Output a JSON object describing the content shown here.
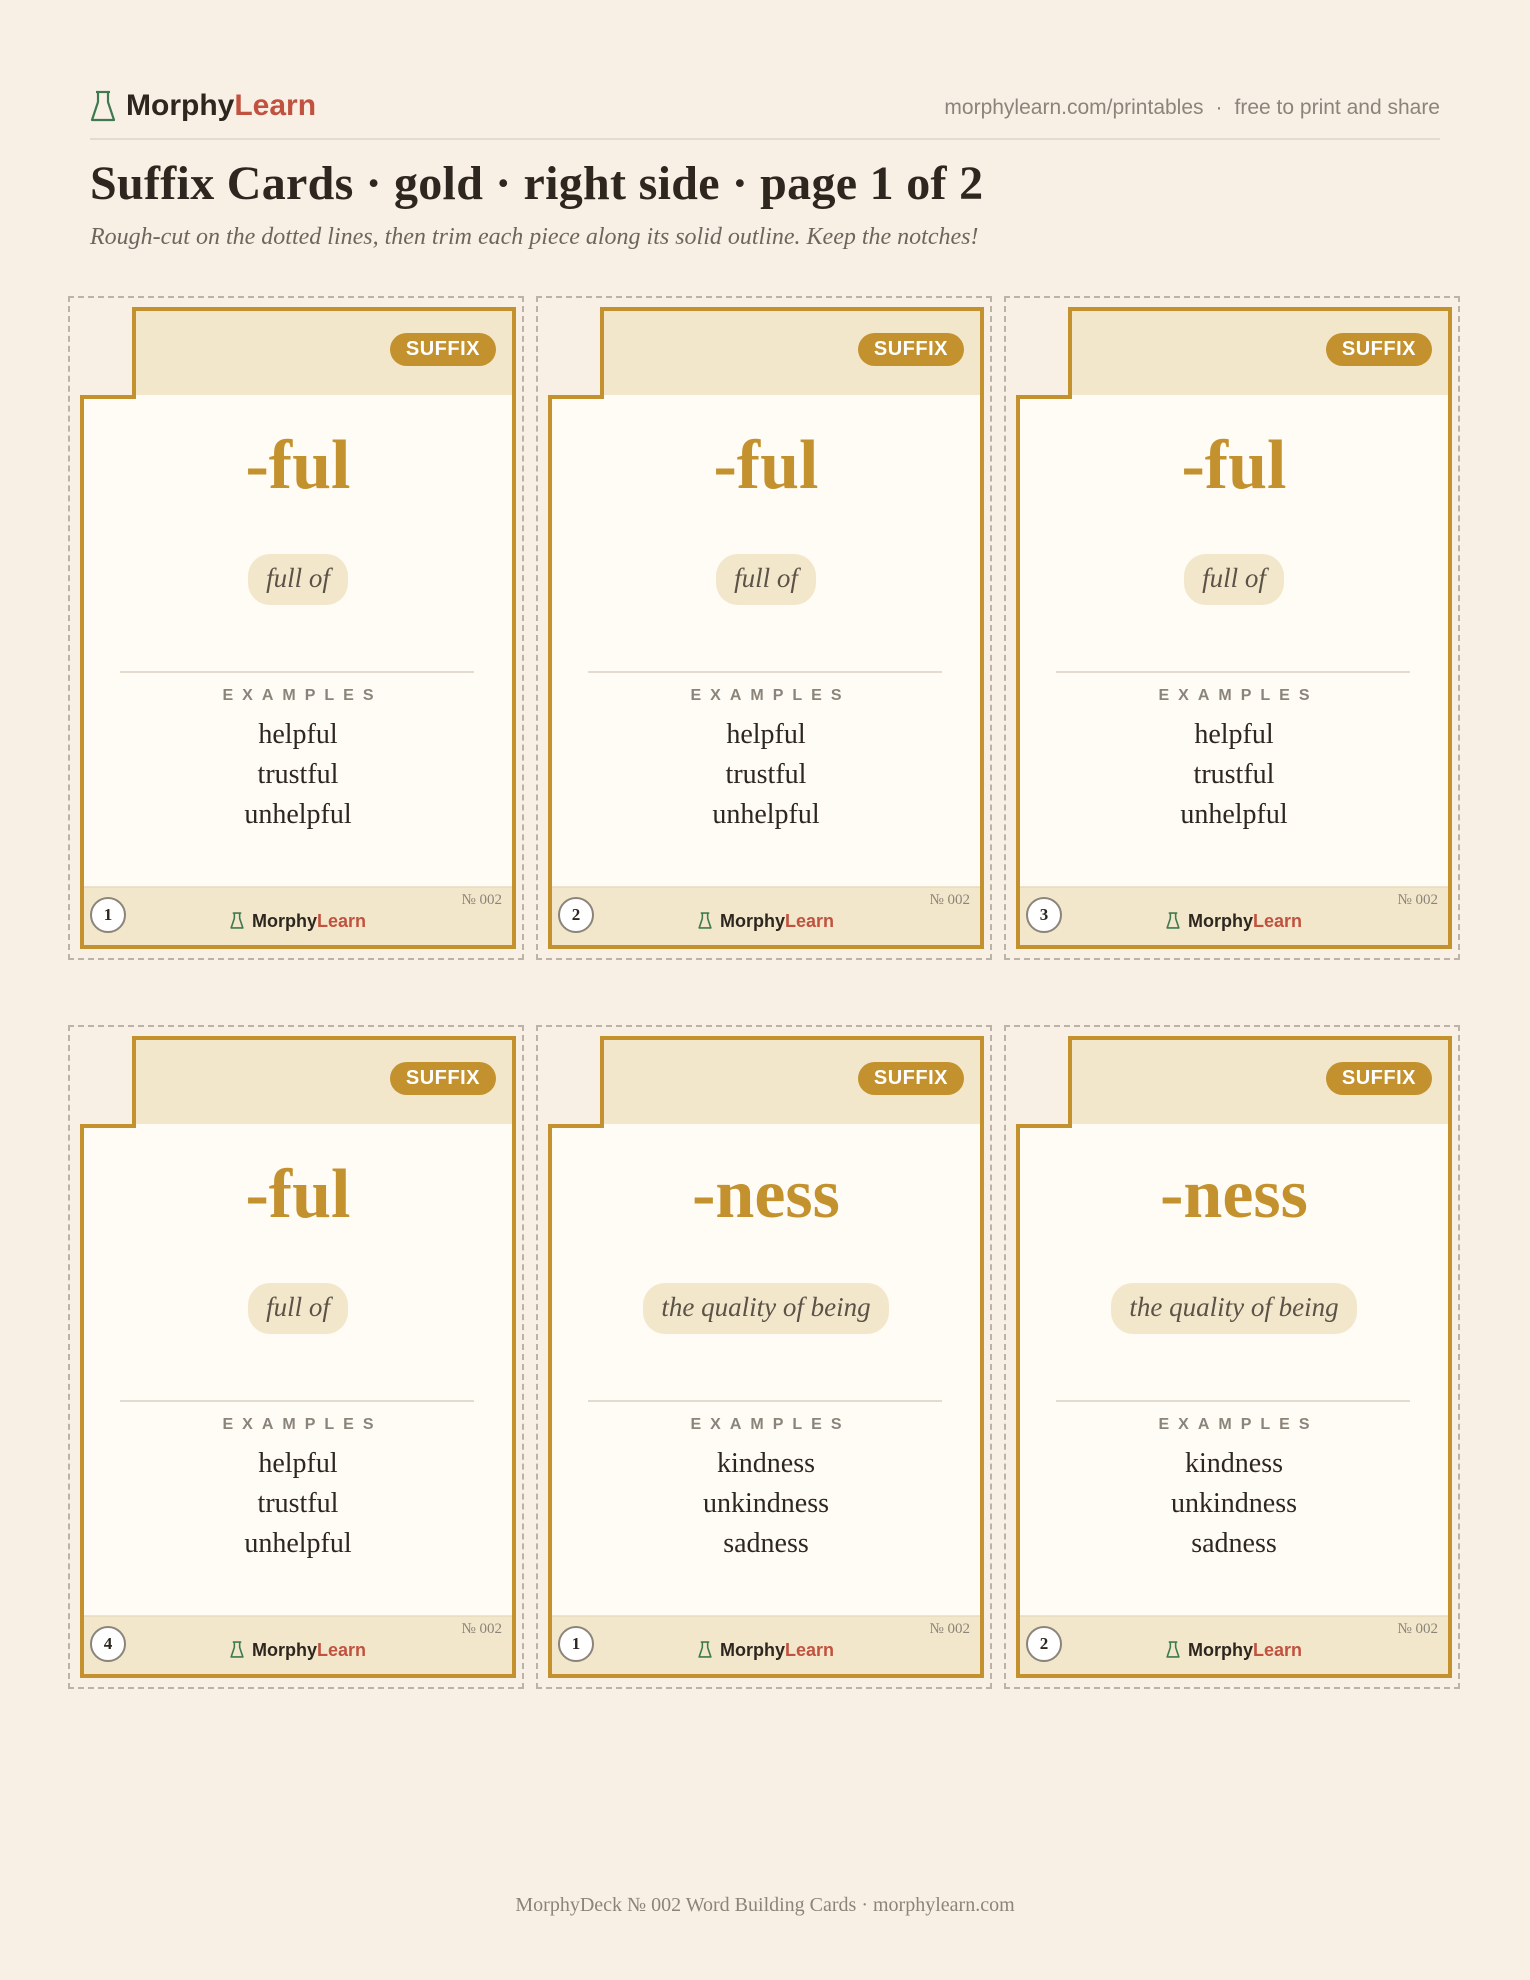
{
  "header": {
    "brand_first": "Morphy",
    "brand_second": "Learn",
    "url": "morphylearn.com/printables",
    "separator": "·",
    "tagline": "free to print and share"
  },
  "title": {
    "part1": "Suffix Cards",
    "part2": "gold",
    "part3": "right side",
    "part4": "page 1 of 2",
    "dot": "·"
  },
  "subtitle": "Rough-cut on the dotted lines, then trim each piece along its solid outline. Keep the notches!",
  "card_common": {
    "badge": "SUFFIX",
    "examples_label": "EXAMPLES",
    "brand_first": "Morphy",
    "brand_second": "Learn",
    "deck_no": "№ 002"
  },
  "cards": [
    {
      "suffix": "-ful",
      "meaning": "full of",
      "examples": [
        "helpful",
        "trustful",
        "unhelpful"
      ],
      "number": "1"
    },
    {
      "suffix": "-ful",
      "meaning": "full of",
      "examples": [
        "helpful",
        "trustful",
        "unhelpful"
      ],
      "number": "2"
    },
    {
      "suffix": "-ful",
      "meaning": "full of",
      "examples": [
        "helpful",
        "trustful",
        "unhelpful"
      ],
      "number": "3"
    },
    {
      "suffix": "-ful",
      "meaning": "full of",
      "examples": [
        "helpful",
        "trustful",
        "unhelpful"
      ],
      "number": "4"
    },
    {
      "suffix": "-ness",
      "meaning": "the quality of being",
      "examples": [
        "kindness",
        "unkindness",
        "sadness"
      ],
      "number": "1"
    },
    {
      "suffix": "-ness",
      "meaning": "the quality of being",
      "examples": [
        "kindness",
        "unkindness",
        "sadness"
      ],
      "number": "2"
    }
  ],
  "footer": "MorphyDeck № 002 Word Building Cards · morphylearn.com",
  "colors": {
    "accent_gold": "#c3922e",
    "brand_learn": "#c0523f",
    "page_bg": "#f8f0e5",
    "card_bg": "#fffbf5",
    "band_bg": "#f3e7cb"
  },
  "icons": {
    "brand": "flask-icon"
  }
}
